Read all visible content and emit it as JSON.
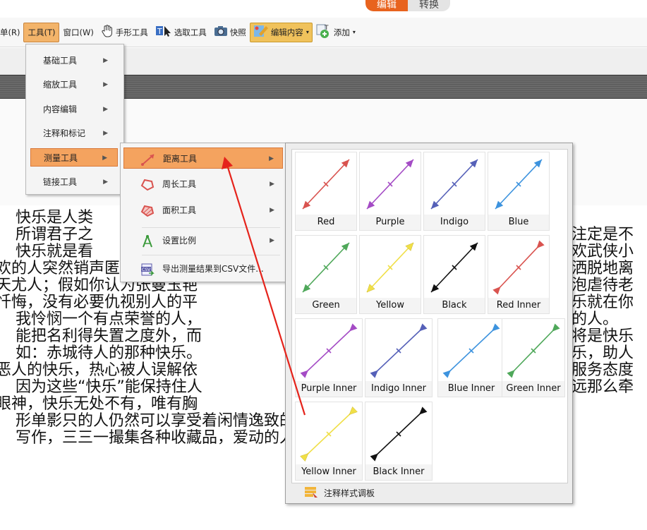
{
  "top_tabs": [
    {
      "label": "编辑",
      "active": true
    },
    {
      "label": "转换",
      "active": false
    }
  ],
  "toolbar": {
    "partial_menu": "单(R)",
    "tools_menu": "工具(T)",
    "window_menu": "窗口(W)",
    "hand_tool": "手形工具",
    "select_tool": "选取工具",
    "snapshot": "快照",
    "edit_content": "编辑内容",
    "add": "添加",
    "icons": [
      "hand-icon",
      "text-select-icon",
      "camera-icon",
      "edit-content-icon",
      "add-text-icon"
    ]
  },
  "tools_menu": {
    "items": [
      {
        "label": "基础工具",
        "has_submenu": true
      },
      {
        "label": "缩放工具",
        "has_submenu": true
      },
      {
        "label": "内容编辑",
        "has_submenu": true
      },
      {
        "label": "注释和标记",
        "has_submenu": true
      },
      {
        "label": "测量工具",
        "has_submenu": true,
        "highlighted": true
      },
      {
        "label": "链接工具",
        "has_submenu": true
      }
    ]
  },
  "measure_menu": {
    "items": [
      {
        "label": "距离工具",
        "icon": "distance-tool-icon",
        "has_submenu": true,
        "highlighted": true
      },
      {
        "label": "周长工具",
        "icon": "perimeter-tool-icon",
        "has_submenu": true
      },
      {
        "label": "面积工具",
        "icon": "area-tool-icon",
        "has_submenu": true
      },
      {
        "label": "设置比例",
        "icon": "scale-icon",
        "has_submenu": true
      },
      {
        "label": "导出测量结果到CSV文件...",
        "icon": "csv-export-icon",
        "has_submenu": false
      }
    ]
  },
  "style_palette": {
    "swatches": [
      {
        "label": "Red",
        "color": "#d9534f",
        "style": "arrow"
      },
      {
        "label": "Purple",
        "color": "#a44bc5",
        "style": "arrow"
      },
      {
        "label": "Indigo",
        "color": "#5560b8",
        "style": "arrow"
      },
      {
        "label": "Blue",
        "color": "#3d93de",
        "style": "arrow"
      },
      {
        "label": "Green",
        "color": "#4fa85a",
        "style": "arrow"
      },
      {
        "label": "Yellow",
        "color": "#f0df47",
        "style": "arrow"
      },
      {
        "label": "Black",
        "color": "#111111",
        "style": "arrow"
      },
      {
        "label": "Red Inner",
        "color": "#d9534f",
        "style": "inner"
      },
      {
        "label": "Purple Inner",
        "color": "#a44bc5",
        "style": "inner"
      },
      {
        "label": "Indigo Inner",
        "color": "#5560b8",
        "style": "inner"
      },
      {
        "label": "Blue Inner",
        "color": "#3d93de",
        "style": "inner"
      },
      {
        "label": "Green Inner",
        "color": "#4fa85a",
        "style": "inner"
      },
      {
        "label": "Yellow Inner",
        "color": "#f0df47",
        "style": "inner"
      },
      {
        "label": "Black Inner",
        "color": "#111111",
        "style": "inner"
      }
    ],
    "footer": "注释样式调板"
  },
  "document_lines": [
    "快乐是人类",
    "所谓君子之",
    "快乐就是看",
    "欢的人突然销声匿迹，你没有",
    "天尤人；假如你认为张曼玉艳",
    "忏悔，没有必要仇视别人的平",
    "我怜悯一个有点荣誉的人，",
    "能把名利得失置之度外，而",
    "如：赤城待人的那种快乐。",
    "恶人的快乐，热心被人误解依",
    "因为这些“快乐”能保持住人",
    "眼神，快乐无处不有，唯有胸",
    "形单影只的人仍然可以享受着闲情逸致的快乐。东山东水各不相",
    "写作，三三一撮集各种收藏品，爱动的人则不妨练习舞蹈，慢跑"
  ],
  "document_right": [
    "注定是不",
    "欢武侠小",
    "洒脱地离",
    "泡虐待老",
    "乐就在你",
    "的人。",
    "将是快乐",
    "乐，助人",
    "服务态度",
    "远那么牵"
  ],
  "colors": {
    "accent": "#e8631e",
    "menu_highlight": "#f4a35f",
    "annotation_arrow": "#e5231b"
  }
}
